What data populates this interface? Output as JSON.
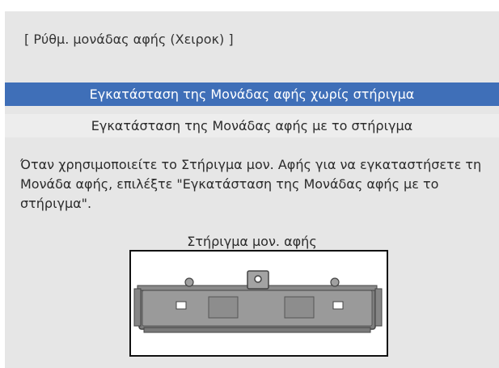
{
  "dialog": {
    "title": "[ Ρύθμ. μονάδας αφής (Χειροκ) ]",
    "options": [
      {
        "label": "Εγκατάσταση της Μονάδας αφής χωρίς στήριγμα",
        "selected": true
      },
      {
        "label": "Εγκατάσταση της Μονάδας αφής με το στήριγμα",
        "selected": false
      }
    ],
    "description": "Όταν χρησιμοποιείτε το Στήριγμα μον. Αφής για να εγκαταστήσετε τη Μονάδα αφής, επιλέξτε \"Εγκατάσταση της Μονάδας αφής με το στήριγμα\".",
    "figure_caption": "Στήριγμα μον. αφής"
  },
  "colors": {
    "selected_bg": "#3f6fb8",
    "panel_bg": "#e6e6e6"
  },
  "icons": {
    "figure": "touch-unit-bracket-illustration"
  }
}
